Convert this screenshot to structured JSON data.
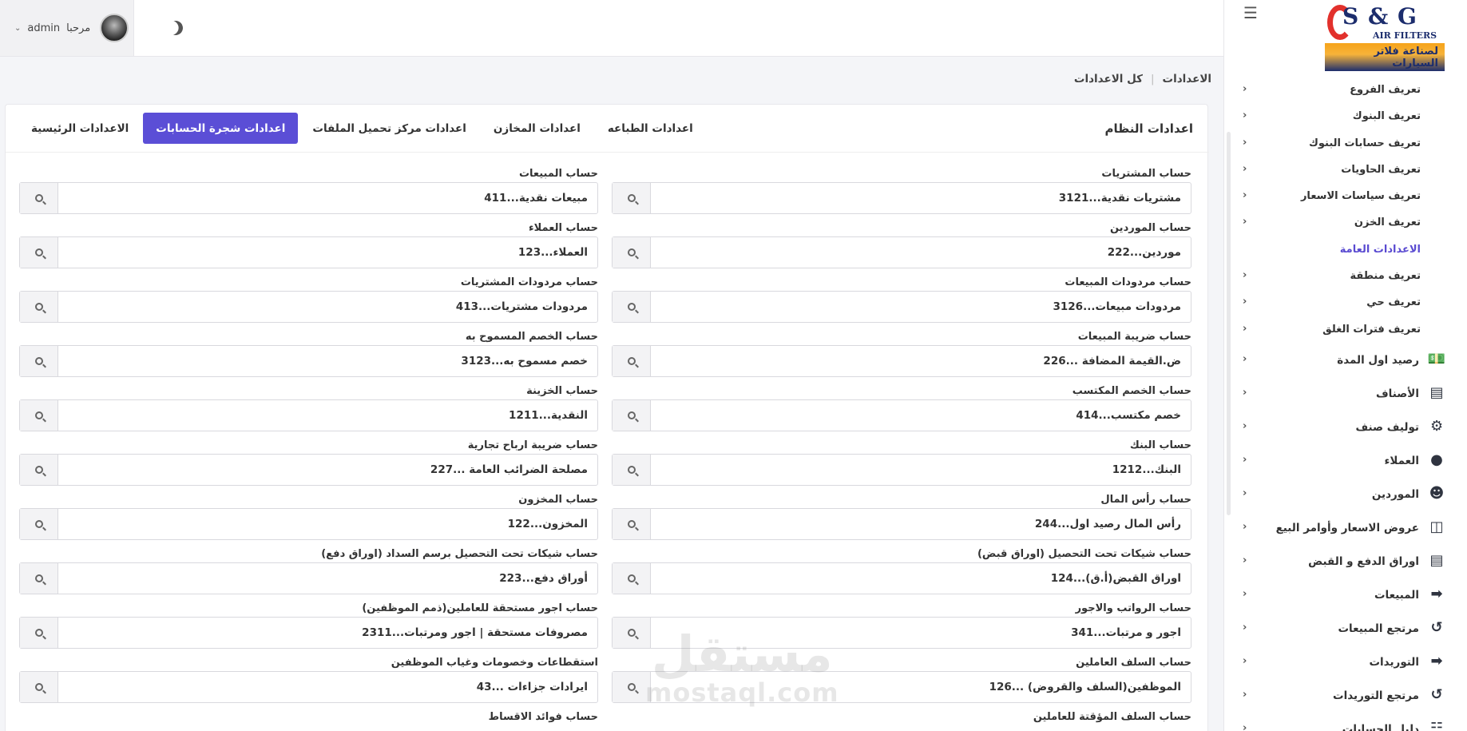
{
  "header": {
    "user_name": "admin",
    "greeting": "مرحبا",
    "theme_icon": "moon-icon"
  },
  "sidebar": {
    "logo": {
      "brand": "S & G",
      "subtitle": "AIR FILTERS",
      "arabic_tagline": "لصناعة فلاتر السيارات"
    },
    "items": [
      {
        "label": "تعريف الفروع",
        "active": false
      },
      {
        "label": "تعريف البنوك",
        "active": false
      },
      {
        "label": "تعريف حسابات البنوك",
        "active": false
      },
      {
        "label": "تعريف الحاويات",
        "active": false
      },
      {
        "label": "تعريف سياسات الاسعار",
        "active": false
      },
      {
        "label": "تعريف الخزن",
        "active": false
      },
      {
        "label": "الاعدادات العامة",
        "active": true
      },
      {
        "label": "تعريف منطقة",
        "active": false
      },
      {
        "label": "تعريف حي",
        "active": false
      },
      {
        "label": "تعريف فترات الغلق",
        "active": false
      }
    ],
    "sections": [
      {
        "label": "رصيد اول المدة",
        "icon": "money-icon"
      },
      {
        "label": "الأصناف",
        "icon": "sitemap-icon"
      },
      {
        "label": "توليف صنف",
        "icon": "robot-icon"
      },
      {
        "label": "العملاء",
        "icon": "user-icon"
      },
      {
        "label": "الموردين",
        "icon": "user-gear-icon"
      },
      {
        "label": "عروض الاسعار وأوامر البيع",
        "icon": "coins-icon"
      },
      {
        "label": "اوراق الدفع و القبض",
        "icon": "card-icon"
      },
      {
        "label": "المبيعات",
        "icon": "arrow-circle-icon"
      },
      {
        "label": "مرتجع المبيعات",
        "icon": "undo-icon"
      },
      {
        "label": "التوريدات",
        "icon": "arrow-circle-icon"
      },
      {
        "label": "مرتجع التوريدات",
        "icon": "undo-icon"
      },
      {
        "label": "دليل الحسابات",
        "icon": "tree-icon"
      }
    ]
  },
  "breadcrumb": {
    "root": "الاعدادات",
    "current": "كل الاعدادات"
  },
  "card": {
    "title": "اعدادات النظام",
    "tabs": [
      {
        "label": "الاعدادات الرئيسية",
        "active": false
      },
      {
        "label": "اعدادات شجرة الحسابات",
        "active": true
      },
      {
        "label": "اعدادات مركز تحميل الملفات",
        "active": false
      },
      {
        "label": "اعدادات المخازن",
        "active": false
      },
      {
        "label": "اعدادات الطباعه",
        "active": false
      }
    ]
  },
  "fields_right": [
    {
      "label": "حساب المشتريات",
      "value": "مشتريات نقدية...3121"
    },
    {
      "label": "حساب الموردين",
      "value": "موردين...222"
    },
    {
      "label": "حساب مردودات المبيعات",
      "value": "مردودات مبيعات...3126"
    },
    {
      "label": "حساب ضريبة المبيعات",
      "value": "ض.القيمة المضافة ...226"
    },
    {
      "label": "حساب الخصم المكتسب",
      "value": "خصم مكتسب...414"
    },
    {
      "label": "حساب البنك",
      "value": "البنك...1212"
    },
    {
      "label": "حساب رأس المال",
      "value": "رأس المال رصيد اول...244"
    },
    {
      "label": "حساب شيكات تحت التحصيل (اوراق قبض)",
      "value": "اوراق القبض(أ.ق)...124"
    },
    {
      "label": "حساب الرواتب والاجور",
      "value": "اجور و مرتبات...341"
    },
    {
      "label": "حساب السلف العاملين",
      "value": "الموظفين(السلف والقروض) ...126"
    },
    {
      "label": "حساب السلف المؤقتة للعاملين",
      "value": ""
    }
  ],
  "fields_left": [
    {
      "label": "حساب المبيعات",
      "value": "مبيعات نقدية...411"
    },
    {
      "label": "حساب العملاء",
      "value": "العملاء...123"
    },
    {
      "label": "حساب مردودات المشتريات",
      "value": "مردودات مشتريات...413"
    },
    {
      "label": "حساب الخصم المسموح به",
      "value": "خصم مسموح به...3123"
    },
    {
      "label": "حساب الخزينة",
      "value": "النقدية...1211"
    },
    {
      "label": "حساب ضريبة ارباح تجارية",
      "value": "مصلحة الضرائب العامة ...227"
    },
    {
      "label": "حساب المخزون",
      "value": "المخزون...122"
    },
    {
      "label": "حساب شيكات تحت التحصيل برسم السداد (اوراق دفع)",
      "value": "أوراق دفع...223"
    },
    {
      "label": "حساب اجور مستحقة للعاملين(ذمم الموظفين)",
      "value": "مصروفات مستحقة | اجور ومرتبات...2311"
    },
    {
      "label": "استقطاعات وخصومات وغياب الموظفين",
      "value": "ايرادات جزاءات  ...43"
    },
    {
      "label": "حساب فوائد الاقساط",
      "value": ""
    }
  ],
  "watermark": {
    "arabic": "مستقل",
    "latin": "mostaql.com"
  },
  "colors": {
    "accent": "#5b4ed6",
    "active_nav": "#5a4bd1",
    "logo_navy": "#1c2d6d",
    "logo_red": "#e2312c",
    "logo_orange": "#f6a31a"
  }
}
